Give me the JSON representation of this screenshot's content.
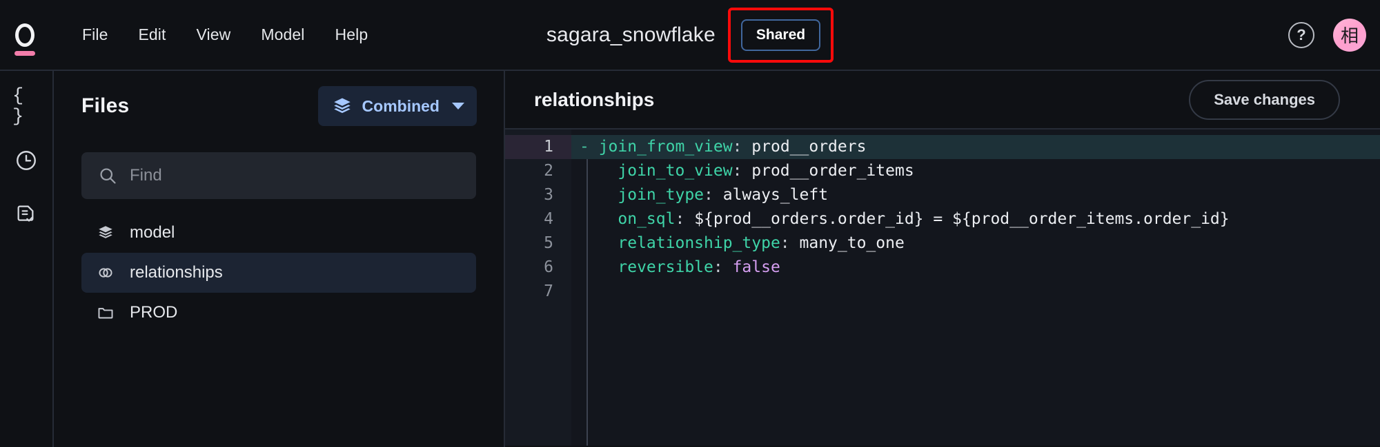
{
  "topbar": {
    "logo_icon": "ring-logo-icon",
    "menus": [
      {
        "label": "File"
      },
      {
        "label": "Edit"
      },
      {
        "label": "View"
      },
      {
        "label": "Model"
      },
      {
        "label": "Help"
      }
    ],
    "title": "sagara_snowflake",
    "shared_badge": "Shared",
    "help_icon_glyph": "?",
    "avatar_initial": "相",
    "annotation_color": "#fb0a0a",
    "avatar_color": "#ffb0d6",
    "logo_accent_color": "#f27daa"
  },
  "icon_rail": {
    "items": [
      {
        "name": "braces-icon",
        "glyph": "{ }"
      },
      {
        "name": "clock-icon",
        "glyph": ""
      },
      {
        "name": "document-check-icon",
        "glyph": ""
      }
    ]
  },
  "files_panel": {
    "title": "Files",
    "mode_selector": {
      "label": "Combined",
      "icon": "layers-icon",
      "caret": "chevron-down-icon",
      "accent_color": "#a6c8ff"
    },
    "search": {
      "placeholder": "Find",
      "value": "",
      "icon": "search-icon"
    },
    "items": [
      {
        "label": "model",
        "icon": "layers-icon",
        "selected": false
      },
      {
        "label": "relationships",
        "icon": "link-rings-icon",
        "selected": true
      },
      {
        "label": "PROD",
        "icon": "folder-icon",
        "selected": false
      }
    ]
  },
  "editor": {
    "title": "relationships",
    "save_button": "Save changes",
    "active_line": 1,
    "line_numbers": [
      "1",
      "2",
      "3",
      "4",
      "5",
      "6",
      "7"
    ],
    "code_lines": [
      {
        "n": 1,
        "indent": 0,
        "dash": "- ",
        "key": "join_from_view",
        "colon": ": ",
        "value": "prod__orders",
        "value_type": "plain"
      },
      {
        "n": 2,
        "indent": 1,
        "dash": "",
        "key": "join_to_view",
        "colon": ": ",
        "value": "prod__order_items",
        "value_type": "plain"
      },
      {
        "n": 3,
        "indent": 1,
        "dash": "",
        "key": "join_type",
        "colon": ": ",
        "value": "always_left",
        "value_type": "plain"
      },
      {
        "n": 4,
        "indent": 1,
        "dash": "",
        "key": "on_sql",
        "colon": ": ",
        "value": "${prod__orders.order_id} = ${prod__order_items.order_id}",
        "value_type": "plain"
      },
      {
        "n": 5,
        "indent": 1,
        "dash": "",
        "key": "relationship_type",
        "colon": ": ",
        "value": "many_to_one",
        "value_type": "plain"
      },
      {
        "n": 6,
        "indent": 1,
        "dash": "",
        "key": "reversible",
        "colon": ": ",
        "value": "false",
        "value_type": "bool"
      },
      {
        "n": 7,
        "indent": 1,
        "dash": "",
        "key": "",
        "colon": "",
        "value": "",
        "value_type": "plain"
      }
    ],
    "syntax_colors": {
      "key": "#3fd4a8",
      "value": "#eceef2",
      "bool": "#d59ef0",
      "background": "#13161d",
      "active_line": "#1d3138"
    }
  }
}
